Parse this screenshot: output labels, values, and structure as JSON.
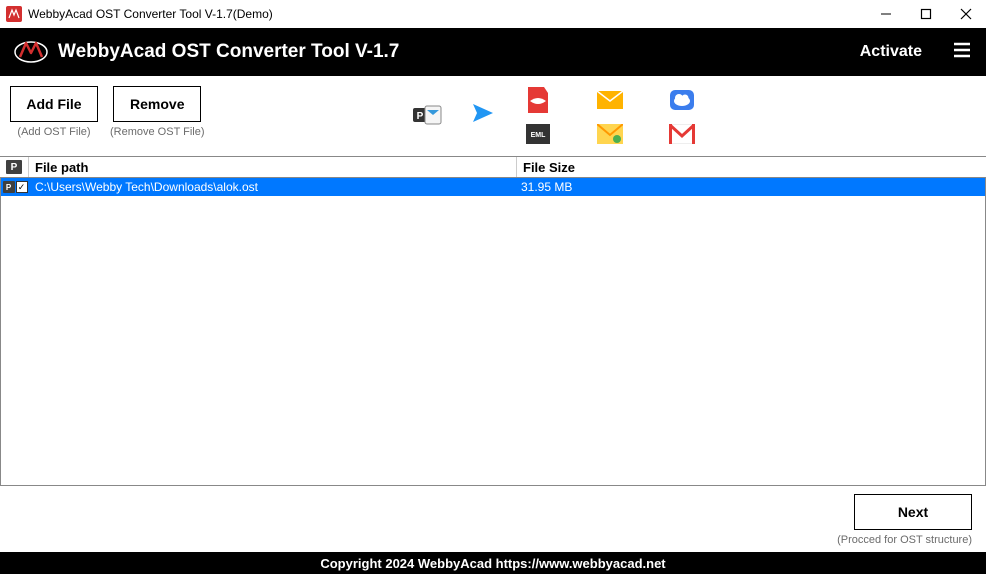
{
  "window": {
    "title": "WebbyAcad OST Converter Tool V-1.7(Demo)"
  },
  "header": {
    "title": "WebbyAcad OST Converter Tool V-1.7",
    "activate": "Activate"
  },
  "toolbar": {
    "add_label": "Add File",
    "add_sub": "(Add OST File)",
    "remove_label": "Remove",
    "remove_sub": "(Remove OST File)"
  },
  "table": {
    "col_path": "File path",
    "col_size": "File Size",
    "rows": [
      {
        "path": "C:\\Users\\Webby Tech\\Downloads\\alok.ost",
        "size": "31.95 MB"
      }
    ]
  },
  "next": {
    "label": "Next",
    "sub": "(Procced for OST structure)"
  },
  "footer": {
    "text": "Copyright 2024 WebbyAcad https://www.webbyacad.net"
  },
  "icons": {
    "source": "pst-icon",
    "targets": [
      "pdf-icon",
      "mail-icon-orange",
      "cloud-icon",
      "eml-icon",
      "msg-icon",
      "gmail-icon"
    ]
  }
}
